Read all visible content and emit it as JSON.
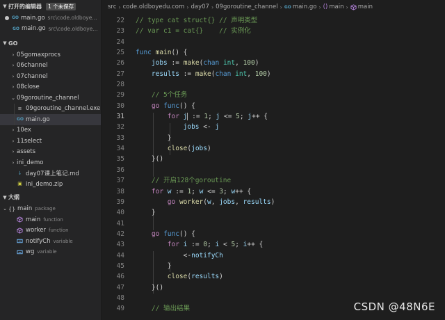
{
  "sidebar": {
    "open_editors": {
      "header": "打开的编辑器",
      "badge": "1 个未保存",
      "items": [
        {
          "name": "main.go",
          "desc": "src\\code.oldboye..."
        },
        {
          "name": "main.go",
          "desc": "src\\code.oldboye..."
        }
      ]
    },
    "folder": {
      "header": "GO",
      "items": [
        {
          "label": "05gomaxprocs"
        },
        {
          "label": "06channel"
        },
        {
          "label": "07channel"
        },
        {
          "label": "08close"
        },
        {
          "label": "09goroutine_channel"
        },
        {
          "label": "09goroutine_channel.exe"
        },
        {
          "label": "main.go"
        },
        {
          "label": "10ex"
        },
        {
          "label": "11select"
        },
        {
          "label": "assets"
        },
        {
          "label": "ini_demo"
        },
        {
          "label": "day07课上笔记.md"
        },
        {
          "label": "ini_demo.zip"
        }
      ]
    },
    "outline": {
      "header": "大纲",
      "root": {
        "name": "main",
        "kind": "package"
      },
      "items": [
        {
          "name": "main",
          "kind": "function"
        },
        {
          "name": "worker",
          "kind": "function"
        },
        {
          "name": "notifyCh",
          "kind": "variable"
        },
        {
          "name": "wg",
          "kind": "variable"
        }
      ]
    },
    "colors": {
      "function_icon": "#b180d7",
      "variable_icon": "#75beff"
    }
  },
  "breadcrumb": {
    "parts": [
      "src",
      "code.oldboyedu.com",
      "day07",
      "09goroutine_channel",
      "main.go",
      "main"
    ],
    "go_icon_text": "GO",
    "func_icon_text": "()"
  },
  "editor": {
    "line_numbers": [
      "22",
      "23",
      "24",
      "25",
      "26",
      "27",
      "28",
      "29",
      "30",
      "31",
      "32",
      "33",
      "34",
      "35",
      "36",
      "37",
      "38",
      "39",
      "40",
      "41",
      "42",
      "43",
      "44",
      "45",
      "46",
      "47",
      "48",
      "49"
    ],
    "active_line": "31"
  },
  "watermark": "CSDN @48N6E"
}
